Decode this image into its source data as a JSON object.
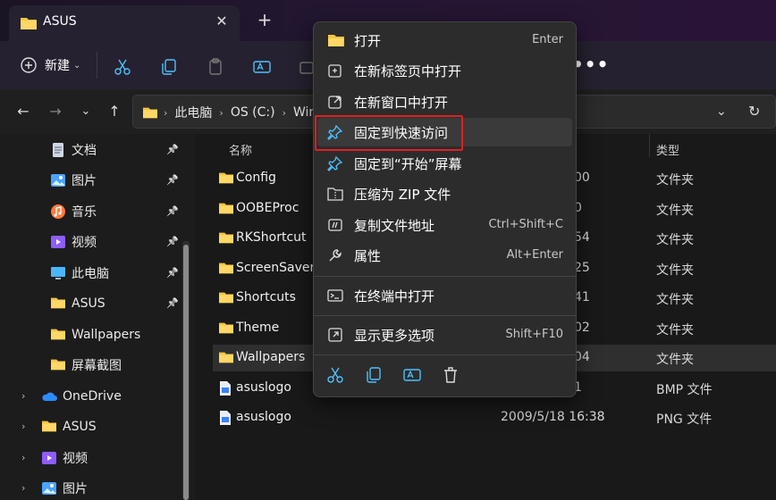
{
  "tab": {
    "title": "ASUS",
    "close": "✕",
    "new_tab": "+"
  },
  "toolbar": {
    "new_label": "新建",
    "more": "•••"
  },
  "address": {
    "crumbs": [
      "此电脑",
      "OS (C:)",
      "Wind"
    ]
  },
  "sidebar": {
    "items": [
      {
        "label": "文档",
        "icon": "documents-icon",
        "pinned": true
      },
      {
        "label": "图片",
        "icon": "pictures-icon",
        "pinned": true
      },
      {
        "label": "音乐",
        "icon": "music-icon",
        "pinned": true
      },
      {
        "label": "视频",
        "icon": "videos-icon",
        "pinned": true
      },
      {
        "label": "此电脑",
        "icon": "computer-icon",
        "pinned": true
      },
      {
        "label": "ASUS",
        "icon": "folder-icon",
        "pinned": true
      },
      {
        "label": "Wallpapers",
        "icon": "folder-icon",
        "pinned": false
      },
      {
        "label": "屏幕截图",
        "icon": "folder-icon",
        "pinned": false
      }
    ],
    "tree": [
      {
        "label": "OneDrive",
        "icon": "onedrive-icon"
      },
      {
        "label": "ASUS",
        "icon": "folder-icon"
      },
      {
        "label": "视频",
        "icon": "videos-icon"
      },
      {
        "label": "图片",
        "icon": "pictures-icon"
      }
    ]
  },
  "filelist": {
    "headers": {
      "name": "名称",
      "type": "类型"
    },
    "rows": [
      {
        "name": "Config",
        "date": "00",
        "type": "文件夹",
        "icon": "folder-icon"
      },
      {
        "name": "OOBEProc",
        "date": "0",
        "type": "文件夹",
        "icon": "folder-icon"
      },
      {
        "name": "RKShortcut",
        "date": "54",
        "type": "文件夹",
        "icon": "folder-icon"
      },
      {
        "name": "ScreenSaver",
        "date": "25",
        "type": "文件夹",
        "icon": "folder-icon"
      },
      {
        "name": "Shortcuts",
        "date": "41",
        "type": "文件夹",
        "icon": "folder-icon"
      },
      {
        "name": "Theme",
        "date": "02",
        "type": "文件夹",
        "icon": "folder-icon"
      },
      {
        "name": "Wallpapers",
        "date": "04",
        "type": "文件夹",
        "icon": "folder-icon",
        "selected": true
      },
      {
        "name": "asuslogo",
        "date": "1",
        "type": "BMP 文件",
        "icon": "image-file-icon"
      },
      {
        "name": "asuslogo",
        "date": "2009/5/18 16:38",
        "type": "PNG 文件",
        "icon": "image-file-icon"
      }
    ]
  },
  "context_menu": {
    "items": [
      {
        "label": "打开",
        "shortcut": "Enter",
        "icon": "folder-open-icon"
      },
      {
        "label": "在新标签页中打开",
        "shortcut": "",
        "icon": "new-tab-icon"
      },
      {
        "label": "在新窗口中打开",
        "shortcut": "",
        "icon": "new-window-icon"
      },
      {
        "label": "固定到快速访问",
        "shortcut": "",
        "icon": "pin-icon",
        "hover": true
      },
      {
        "label": "固定到“开始”屏幕",
        "shortcut": "",
        "icon": "pin-start-icon"
      },
      {
        "label": "压缩为 ZIP 文件",
        "shortcut": "",
        "icon": "zip-icon"
      },
      {
        "label": "复制文件地址",
        "shortcut": "Ctrl+Shift+C",
        "icon": "copy-path-icon"
      },
      {
        "label": "属性",
        "shortcut": "Alt+Enter",
        "icon": "properties-icon"
      },
      {
        "label": "在终端中打开",
        "shortcut": "",
        "icon": "terminal-icon"
      },
      {
        "label": "显示更多选项",
        "shortcut": "Shift+F10",
        "icon": "more-options-icon"
      }
    ],
    "quick_actions": [
      "cut-icon",
      "copy-icon",
      "rename-icon",
      "delete-icon"
    ]
  },
  "colors": {
    "accent": "#4cc2ff",
    "folder": "#f5c542",
    "highlight": "#e02020"
  }
}
